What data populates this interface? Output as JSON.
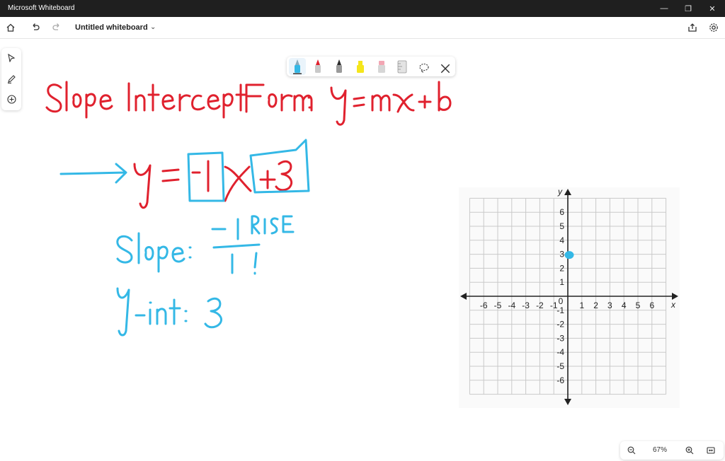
{
  "window": {
    "title": "Microsoft Whiteboard",
    "controls": [
      "minimize-icon",
      "restore-icon",
      "close-icon"
    ]
  },
  "appbar": {
    "board_title": "Untitled whiteboard",
    "icons": [
      "home-icon",
      "undo-icon",
      "redo-icon",
      "share-icon",
      "settings-icon"
    ]
  },
  "side_rail": [
    "select-icon",
    "ink-pen-icon",
    "add-icon"
  ],
  "pen_tray": {
    "pens": [
      {
        "name": "blue-pen",
        "color": "#34b8e6"
      },
      {
        "name": "red-pen",
        "color": "#e0212e"
      },
      {
        "name": "black-pen",
        "color": "#2b2b2b"
      },
      {
        "name": "yellow-highlighter",
        "color": "#f5e61b"
      },
      {
        "name": "eraser",
        "color": "#f2a6b3"
      },
      {
        "name": "ruler",
        "color": "#bdbdbd"
      }
    ],
    "tools": [
      "lasso-icon",
      "close-icon"
    ]
  },
  "handwriting": {
    "heading": "Slope Intercept Form: y = mx+b",
    "equation": "y = -1x +3",
    "slope_label": "Slope:",
    "slope_numerator": "-1",
    "slope_denominator": "1",
    "rise_note": "RISE",
    "yint_label": "y-int:",
    "yint_value": "3",
    "colors": {
      "red": "#e0212e",
      "blue": "#34b8e6"
    }
  },
  "graph": {
    "x_axis_label": "x",
    "y_axis_label": "y",
    "x_ticks": [
      "-6",
      "-5",
      "-4",
      "-3",
      "-2",
      "-1",
      "0",
      "1",
      "2",
      "3",
      "4",
      "5",
      "6"
    ],
    "y_ticks": [
      "6",
      "5",
      "4",
      "3",
      "2",
      "1",
      "-1",
      "-2",
      "-3",
      "-4",
      "-5",
      "-6"
    ],
    "range": [
      -7,
      7
    ],
    "plotted_point": {
      "x": 0,
      "y": 3,
      "color": "#34b8e6"
    }
  },
  "zoom": {
    "value": "67%",
    "icons": [
      "zoom-out-icon",
      "zoom-in-icon",
      "fit-screen-icon"
    ]
  }
}
